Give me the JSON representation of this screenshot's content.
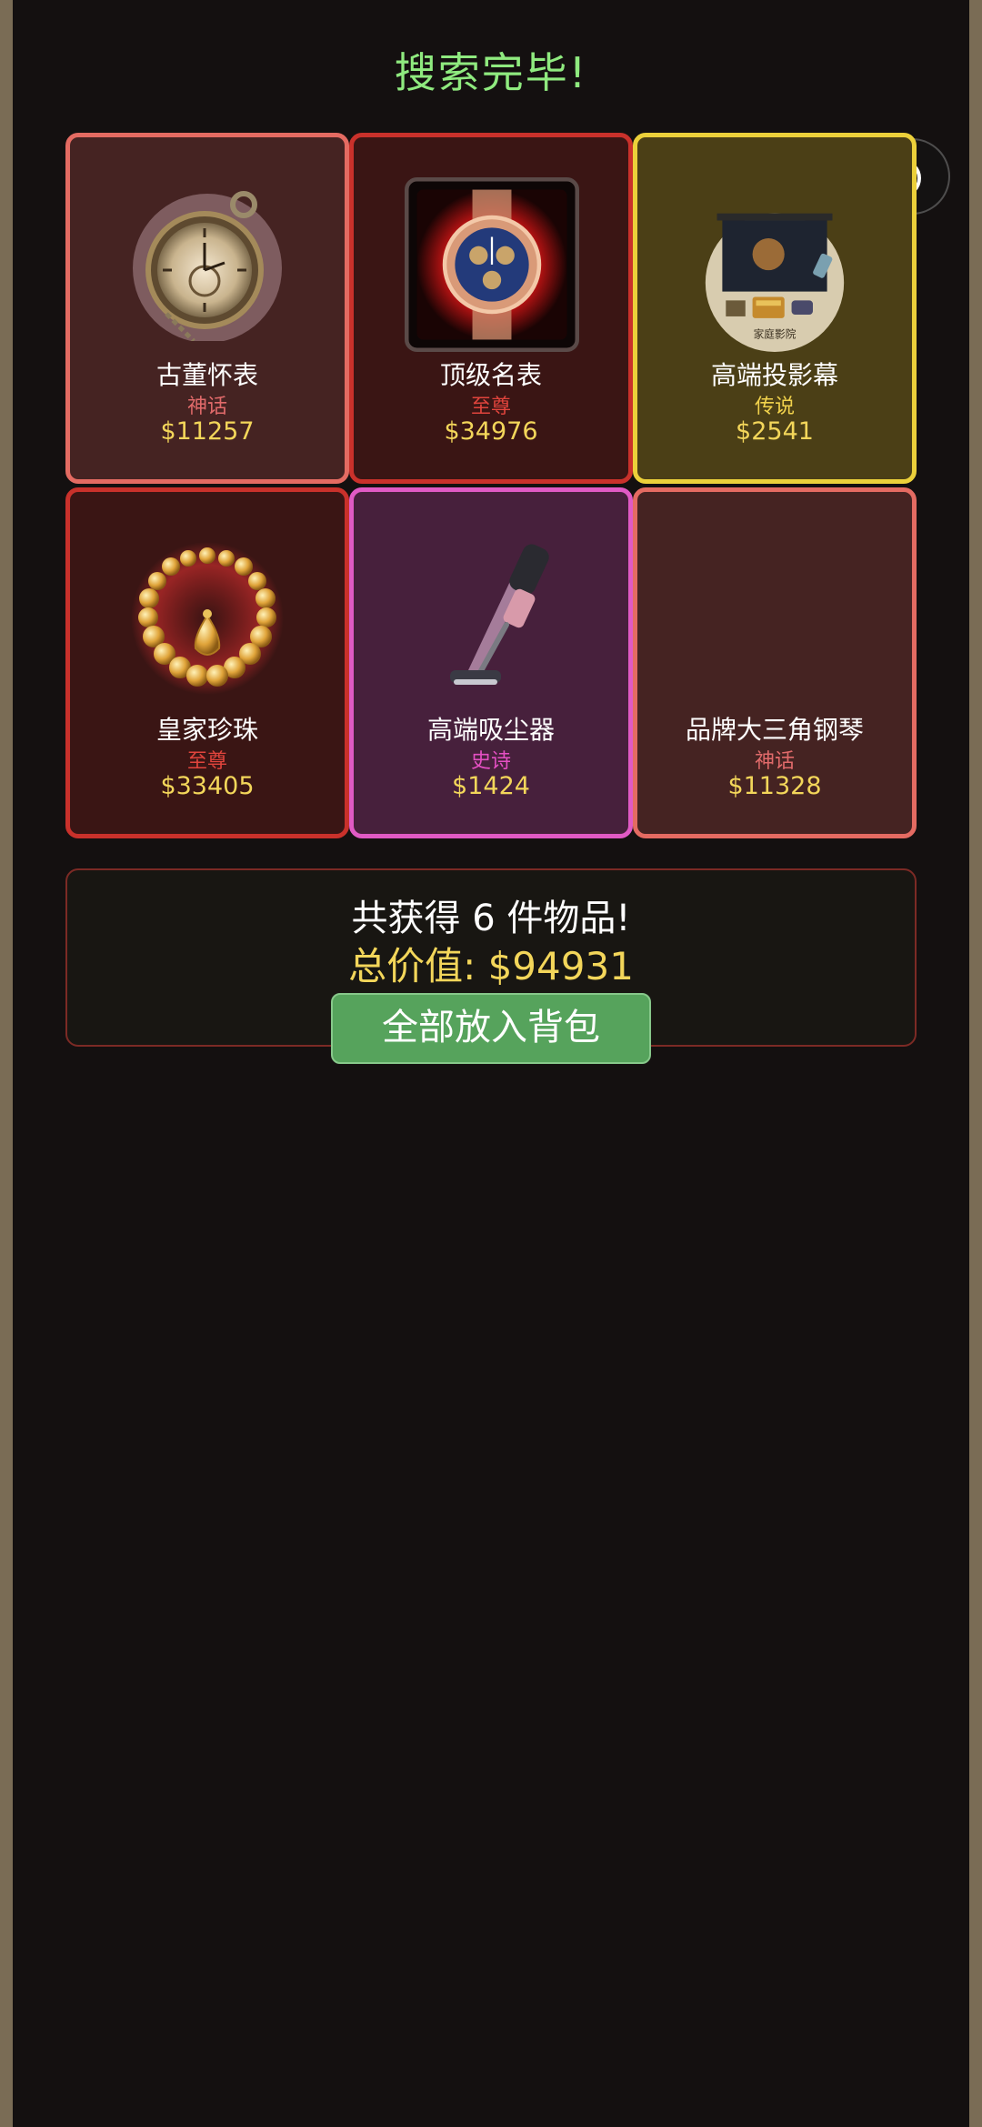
{
  "header": {
    "title": "搜索完毕!"
  },
  "capsule": {
    "more_icon": "more-dots-icon",
    "close_icon": "target-close-icon"
  },
  "items": [
    {
      "name": "古董怀表",
      "rarity": "神话",
      "price": "$11257",
      "icon": "pocket-watch-icon",
      "tier": "mythic"
    },
    {
      "name": "顶级名表",
      "rarity": "至尊",
      "price": "$34976",
      "icon": "luxury-watch-icon",
      "tier": "supreme"
    },
    {
      "name": "高端投影幕",
      "rarity": "传说",
      "price": "$2541",
      "icon": "projector-screen-icon",
      "tier": "legend",
      "art_caption": "家庭影院"
    },
    {
      "name": "皇家珍珠",
      "rarity": "至尊",
      "price": "$33405",
      "icon": "pearl-necklace-icon",
      "tier": "supreme"
    },
    {
      "name": "高端吸尘器",
      "rarity": "史诗",
      "price": "$1424",
      "icon": "vacuum-cleaner-icon",
      "tier": "epic"
    },
    {
      "name": "品牌大三角钢琴",
      "rarity": "神话",
      "price": "$11328",
      "icon": "",
      "tier": "mythic"
    }
  ],
  "summary": {
    "count_text": "共获得 6 件物品!",
    "total_text": "总价值: $94931",
    "collect_button": "全部放入背包"
  },
  "colors": {
    "mythic": "#e46b62",
    "supreme": "#c9312b",
    "legend": "#ecd03a",
    "epic": "#e05ac4",
    "price": "#f3d65a",
    "title": "#8fea7f",
    "button": "#56a35c"
  }
}
